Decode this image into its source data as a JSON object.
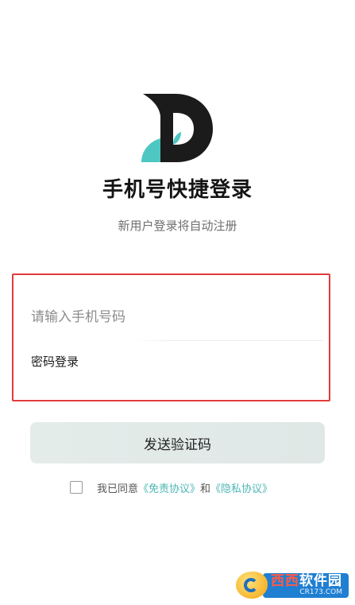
{
  "app": {
    "logo_name": "D-logo",
    "brand_colors": {
      "dark": "#1b1b1b",
      "teal": "#4ec7c2",
      "accent_link": "#4bb7b4"
    }
  },
  "header": {
    "title": "手机号快捷登录",
    "subtitle": "新用户登录将自动注册"
  },
  "form": {
    "phone_placeholder": "请输入手机号码",
    "phone_value": "",
    "password_login_label": "密码登录",
    "highlight_color": "#e23b3b"
  },
  "actions": {
    "send_code_label": "发送验证码"
  },
  "agreement": {
    "checked": false,
    "prefix": "我已同意",
    "terms_link": "《免责协议》",
    "connector": "和",
    "privacy_link": "《隐私协议》"
  },
  "watermark": {
    "main_left": "西西",
    "main_right": "软件园",
    "domain": "CR173.COM"
  }
}
